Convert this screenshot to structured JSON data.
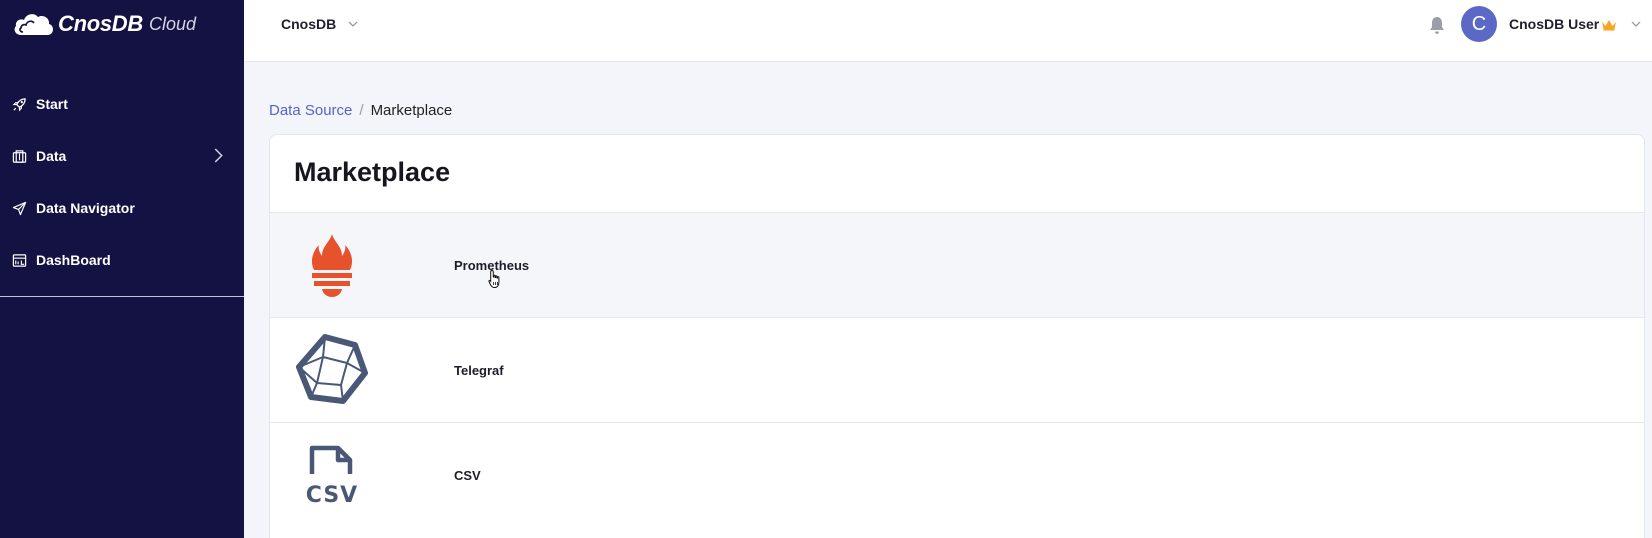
{
  "app": {
    "logo_name": "CnosDB",
    "logo_suffix": "Cloud"
  },
  "sidebar": {
    "items": [
      {
        "label": "Start",
        "icon": "rocket-icon"
      },
      {
        "label": "Data",
        "icon": "data-icon",
        "has_submenu": true
      },
      {
        "label": "Data Navigator",
        "icon": "navigator-icon"
      },
      {
        "label": "DashBoard",
        "icon": "dashboard-icon"
      }
    ]
  },
  "header": {
    "org_name": "CnosDB",
    "avatar_initial": "C",
    "user_name": "CnosDB User"
  },
  "breadcrumb": {
    "parent": "Data Source",
    "separator": "/",
    "current": "Marketplace"
  },
  "page": {
    "title": "Marketplace"
  },
  "marketplace": {
    "items": [
      {
        "name": "Prometheus",
        "icon": "prometheus-icon",
        "color": "#e6522c"
      },
      {
        "name": "Telegraf",
        "icon": "telegraf-icon",
        "color": "#4a5878"
      },
      {
        "name": "CSV",
        "icon": "csv-icon",
        "color": "#4a5878"
      }
    ]
  },
  "colors": {
    "sidebar_bg": "#141143",
    "accent": "#5563c9",
    "avatar_bg": "#5b68c5",
    "crown": "#f5a623"
  }
}
